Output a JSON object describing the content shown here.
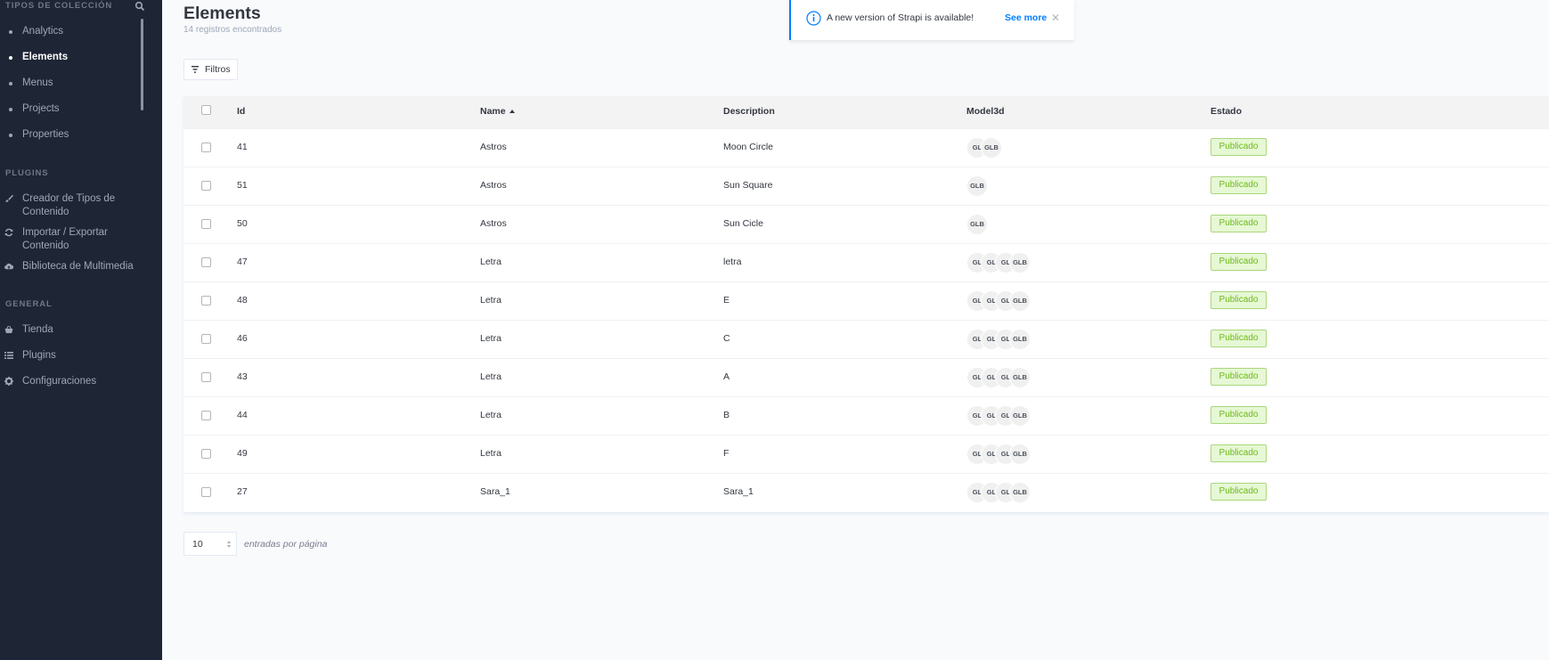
{
  "sidebar": {
    "collection_title": "TIPOS DE COLECCIÓN",
    "collection_items": [
      {
        "label": "Analytics",
        "active": false
      },
      {
        "label": "Elements",
        "active": true
      },
      {
        "label": "Menus",
        "active": false
      },
      {
        "label": "Projects",
        "active": false
      },
      {
        "label": "Properties",
        "active": false
      }
    ],
    "plugins_title": "PLUGINS",
    "plugin_items": [
      {
        "line1": "Creador de Tipos de",
        "line2": "Contenido",
        "icon": "paintbrush-icon"
      },
      {
        "line1": "Importar / Exportar",
        "line2": "Contenido",
        "icon": "sync-icon"
      },
      {
        "line1": "Biblioteca de Multimedia",
        "line2": "",
        "icon": "cloud-upload-icon"
      }
    ],
    "general_title": "GENERAL",
    "general_items": [
      {
        "label": "Tienda",
        "icon": "shop-icon"
      },
      {
        "label": "Plugins",
        "icon": "list-icon"
      },
      {
        "label": "Configuraciones",
        "icon": "gear-icon"
      }
    ]
  },
  "header": {
    "title": "Elements",
    "count": "14 registros encontrados"
  },
  "notification": {
    "message": "A new version of Strapi is available!",
    "link": "See more"
  },
  "filter": {
    "label": "Filtros"
  },
  "table": {
    "headers": {
      "id": "Id",
      "name": "Name",
      "description": "Description",
      "model": "Model3d",
      "status": "Estado"
    },
    "rows": [
      {
        "id": "41",
        "name": "Astros",
        "description": "Moon Circle",
        "chips": [
          "GL",
          "GLB"
        ],
        "status": "Publicado"
      },
      {
        "id": "51",
        "name": "Astros",
        "description": "Sun Square",
        "chips": [
          "GLB"
        ],
        "status": "Publicado"
      },
      {
        "id": "50",
        "name": "Astros",
        "description": "Sun Cicle",
        "chips": [
          "GLB"
        ],
        "status": "Publicado"
      },
      {
        "id": "47",
        "name": "Letra",
        "description": "letra",
        "chips": [
          "GL",
          "GL",
          "GL",
          "GLB"
        ],
        "status": "Publicado"
      },
      {
        "id": "48",
        "name": "Letra",
        "description": "E",
        "chips": [
          "GL",
          "GL",
          "GL",
          "GLB"
        ],
        "status": "Publicado"
      },
      {
        "id": "46",
        "name": "Letra",
        "description": "C",
        "chips": [
          "GL",
          "GL",
          "GL",
          "GLB"
        ],
        "status": "Publicado"
      },
      {
        "id": "43",
        "name": "Letra",
        "description": "A",
        "chips": [
          "GL",
          "GL",
          "GL",
          "GLB"
        ],
        "status": "Publicado"
      },
      {
        "id": "44",
        "name": "Letra",
        "description": "B",
        "chips": [
          "GL",
          "GL",
          "GL",
          "GLB"
        ],
        "status": "Publicado"
      },
      {
        "id": "49",
        "name": "Letra",
        "description": "F",
        "chips": [
          "GL",
          "GL",
          "GL",
          "GLB"
        ],
        "status": "Publicado"
      },
      {
        "id": "27",
        "name": "Sara_1",
        "description": "Sara_1",
        "chips": [
          "GL",
          "GL",
          "GL",
          "GLB"
        ],
        "status": "Publicado"
      }
    ]
  },
  "pagination": {
    "page_size": "10",
    "per_page_label": "entradas por página"
  },
  "colors": {
    "sidebar_bg": "#1e2635",
    "accent": "#007eff",
    "published_bg": "#e6f8d4",
    "published_text": "#6dbb1a"
  }
}
